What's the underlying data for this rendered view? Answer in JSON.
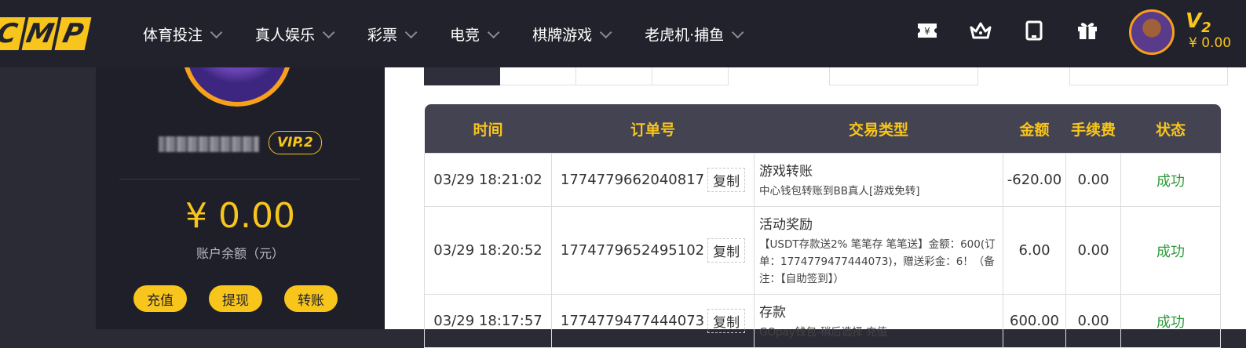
{
  "logo": [
    "C",
    "M",
    "P"
  ],
  "nav": [
    {
      "label": "体育投注"
    },
    {
      "label": "真人娱乐"
    },
    {
      "label": "彩票"
    },
    {
      "label": "电竞"
    },
    {
      "label": "棋牌游戏"
    },
    {
      "label": "老虎机·捕鱼"
    }
  ],
  "top_icons": [
    "ticket-icon",
    "crown-icon",
    "tablet-icon",
    "gift-icon"
  ],
  "user": {
    "vip_level_top": "V",
    "vip_level_num": "2",
    "top_balance": "¥ 0.00",
    "vip_badge": "VIP.2",
    "balance": "¥ 0.00",
    "balance_label": "账户余额（元）"
  },
  "actions": [
    {
      "label": "充值"
    },
    {
      "label": "提现"
    },
    {
      "label": "转账"
    }
  ],
  "table": {
    "headers": [
      "时间",
      "订单号",
      "交易类型",
      "金额",
      "手续费",
      "状态"
    ],
    "copy_label": "复制",
    "rows": [
      {
        "time": "03/29 18:21:02",
        "order": "1774779662040817",
        "type_title": "游戏转账",
        "type_desc": "中心钱包转账到BB真人[游戏免转]",
        "amount": "-620.00",
        "fee": "0.00",
        "status": "成功"
      },
      {
        "time": "03/29 18:20:52",
        "order": "1774779652495102",
        "type_title": "活动奖励",
        "type_desc": "【USDT存款送2% 笔笔存 笔笔送】金额：600(订单：1774779477444073)，赠送彩金：6！（备注：【自助签到】）",
        "amount": "6.00",
        "fee": "0.00",
        "status": "成功"
      },
      {
        "time": "03/29 18:17:57",
        "order": "1774779477444073",
        "type_title": "存款",
        "type_desc": "GOpay钱包-稍后选择 充值",
        "amount": "600.00",
        "fee": "0.00",
        "status": "成功"
      }
    ]
  },
  "colors": {
    "accent": "#f7c51b",
    "header_bg": "#22222c",
    "success": "#2e9a3a"
  }
}
